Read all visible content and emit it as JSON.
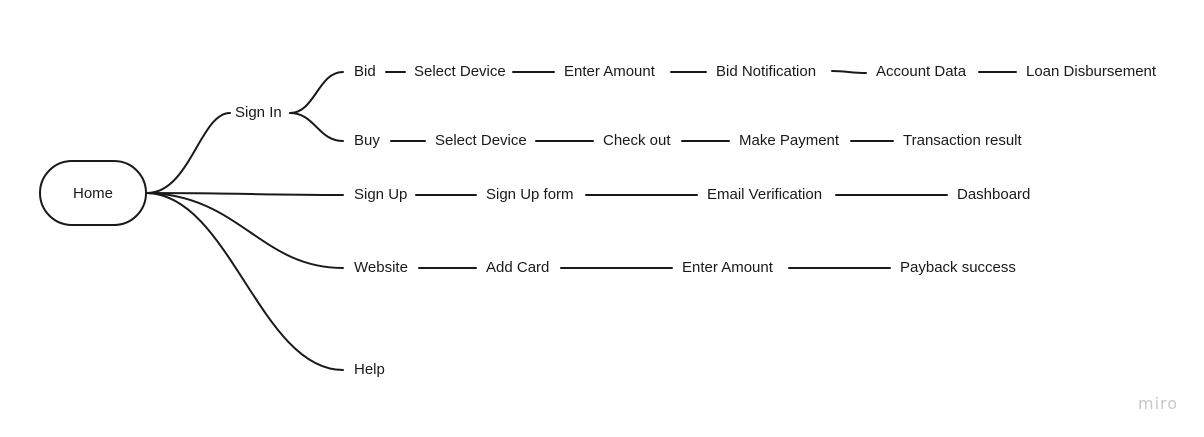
{
  "root": "Home",
  "hub": "Sign In",
  "flows": {
    "bid": [
      "Bid",
      "Select Device",
      "Enter Amount",
      "Bid Notification",
      "Account Data",
      "Loan Disbursement"
    ],
    "buy": [
      "Buy",
      "Select Device",
      "Check out",
      "Make Payment",
      "Transaction result"
    ],
    "signup": [
      "Sign Up",
      "Sign Up form",
      "Email Verification",
      "Dashboard"
    ],
    "website": [
      "Website",
      "Add Card",
      "Enter Amount",
      "Payback success"
    ],
    "help": [
      "Help"
    ]
  },
  "watermark": "miro"
}
